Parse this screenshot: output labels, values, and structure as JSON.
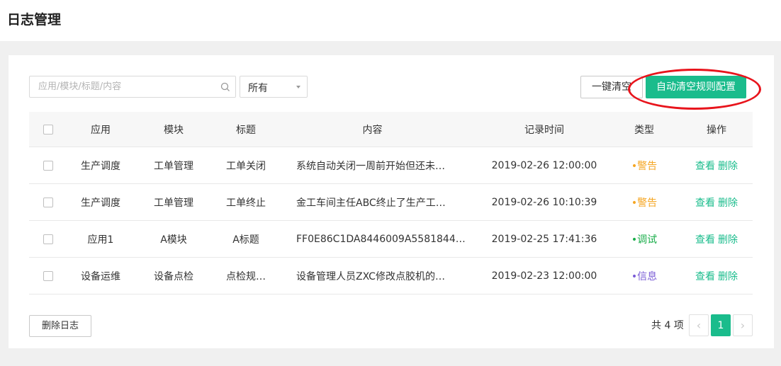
{
  "page_title": "日志管理",
  "search": {
    "placeholder": "应用/模块/标题/内容",
    "value": ""
  },
  "filter": {
    "selected": "所有"
  },
  "toolbar": {
    "clear_label": "一键清空",
    "auto_clear_label": "自动清空规则配置"
  },
  "table": {
    "headers": {
      "app": "应用",
      "module": "模块",
      "title": "标题",
      "content": "内容",
      "time": "记录时间",
      "type": "类型",
      "ops": "操作"
    },
    "rows": [
      {
        "app": "生产调度",
        "module": "工单管理",
        "title": "工单关闭",
        "content": "系统自动关闭一周前开始但还未…",
        "time": "2019-02-26 12:00:00",
        "type": "•警告",
        "view": "查看",
        "delete": "删除"
      },
      {
        "app": "生产调度",
        "module": "工单管理",
        "title": "工单终止",
        "content": "金工车间主任ABC终止了生产工…",
        "time": "2019-02-26 10:10:39",
        "type": "•警告",
        "view": "查看",
        "delete": "删除"
      },
      {
        "app": "应用1",
        "module": "A模块",
        "title": "A标题",
        "content": "FF0E86C1DA8446009A5581844…",
        "time": "2019-02-25 17:41:36",
        "type": "•调试",
        "view": "查看",
        "delete": "删除"
      },
      {
        "app": "设备运维",
        "module": "设备点检",
        "title": "点检规…",
        "content": "设备管理人员ZXC修改点胶机的…",
        "time": "2019-02-23 12:00:00",
        "type": "•信息",
        "view": "查看",
        "delete": "删除"
      }
    ]
  },
  "footer": {
    "delete_log_label": "删除日志",
    "total_text": "共 4 项",
    "current_page": "1",
    "prev_icon": "‹",
    "next_icon": "›"
  },
  "colors": {
    "accent": "#1abc8c",
    "warning": "#f5a623",
    "debug": "#1aad4a",
    "info": "#7a5cd6",
    "annotation": "#e8141c"
  }
}
